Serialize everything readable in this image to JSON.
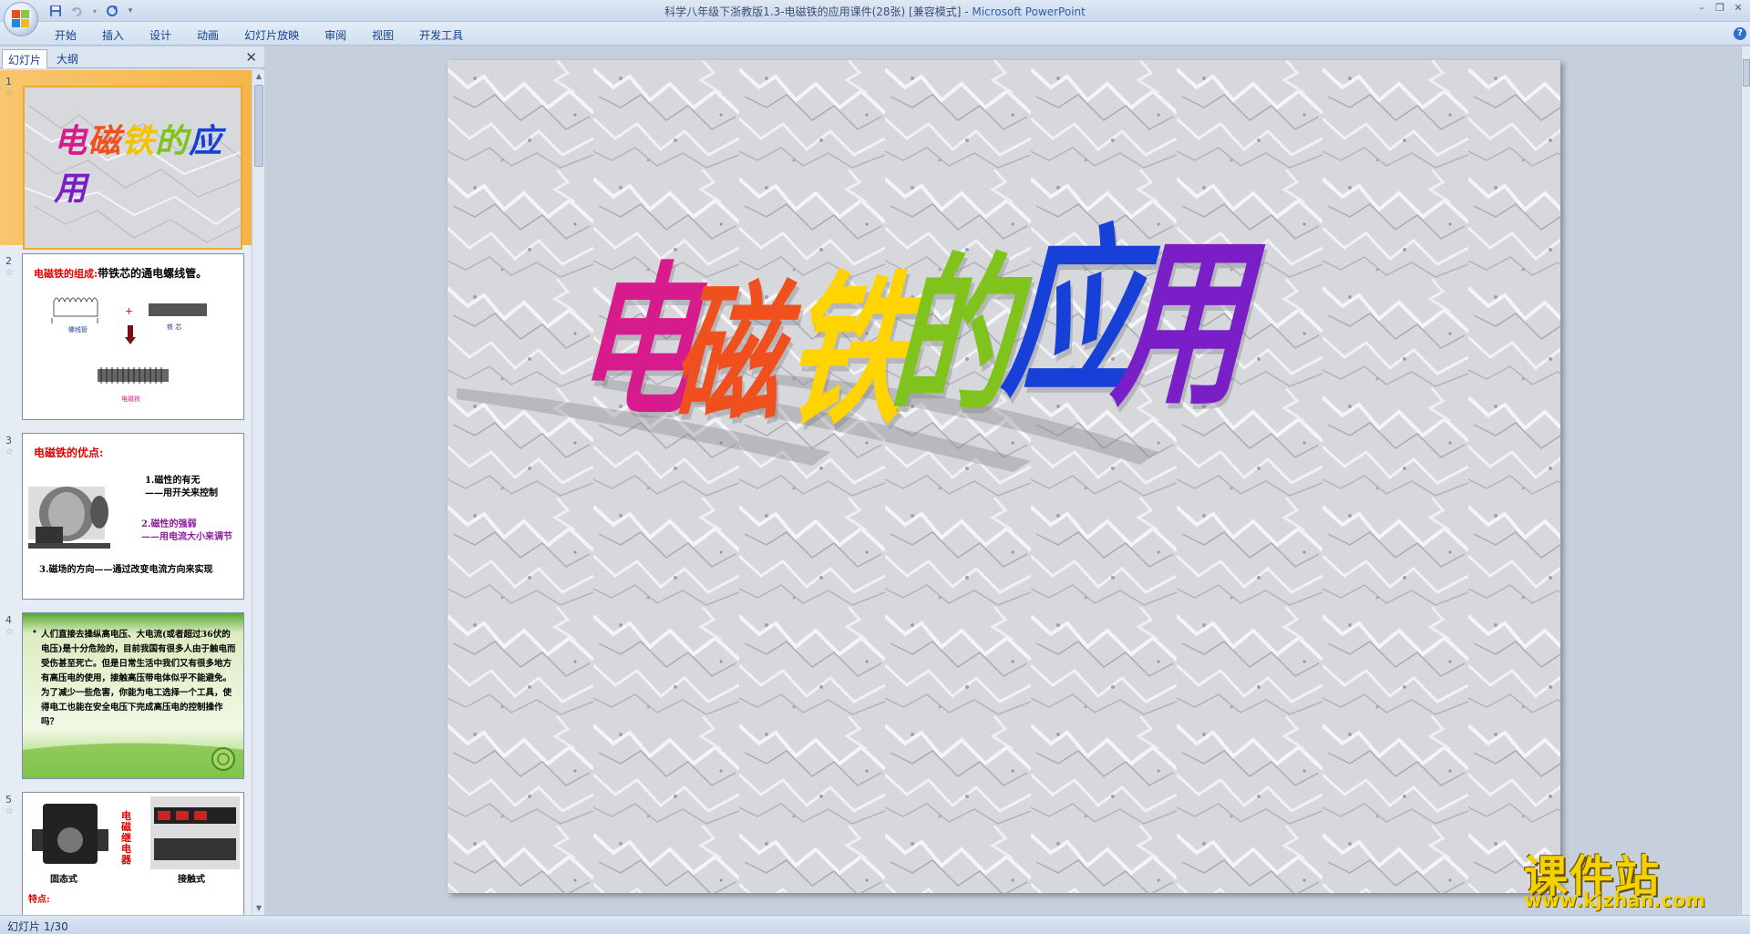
{
  "window": {
    "title": "科学八年级下浙教版1.3-电磁铁的应用课件(28张) [兼容模式] - ",
    "app_name": "Microsoft PowerPoint"
  },
  "ribbon": {
    "tabs": [
      "开始",
      "插入",
      "设计",
      "动画",
      "幻灯片放映",
      "审阅",
      "视图",
      "开发工具"
    ]
  },
  "left_pane": {
    "tab_slides": "幻灯片",
    "tab_outline": "大纲",
    "thumbnails": [
      {
        "num": "1",
        "title": "电磁铁的应用"
      },
      {
        "num": "2",
        "title_red": "电磁铁的组成:",
        "title_black": "带铁芯的通电螺线管。",
        "label_a": "螺线管",
        "label_b": "铁 芯",
        "label_c": "电磁铁",
        "plus": "+"
      },
      {
        "num": "3",
        "title": "电磁铁的优点:",
        "p1": "1.磁性的有无",
        "p1b": "——用开关来控制",
        "p2": "2.磁性的强弱",
        "p2b": "——用电流大小来调节",
        "p3": "3.磁场的方向——通过改变电流方向来实现"
      },
      {
        "num": "4",
        "bullet": "•",
        "text": "人们直接去操纵高电压、大电流(或者超过36伏的电压)是十分危险的，目前我国有很多人由于触电而受伤甚至死亡。但是日常生活中我们又有很多地方有高压电的使用，接触高压带电体似乎不能避免。为了减少一些危害，你能为电工选择一个工具，使得电工也能在安全电压下完成高压电的控制操作吗？"
      },
      {
        "num": "5",
        "label_relay": "电磁继电器",
        "label_solid": "固态式",
        "label_contact": "接触式",
        "label_feature": "特点:"
      }
    ]
  },
  "slide": {
    "title_chars": [
      "电",
      "磁",
      "铁",
      "的",
      "应",
      "用"
    ],
    "title_colors": [
      "#d81b8c",
      "#f0501e",
      "#ffd400",
      "#7fc31c",
      "#1740d8",
      "#7a1ec8"
    ]
  },
  "status": {
    "text": "幻灯片 1/30"
  },
  "watermark": {
    "line1": "课件站",
    "line2": "www.kjzhan.com"
  }
}
